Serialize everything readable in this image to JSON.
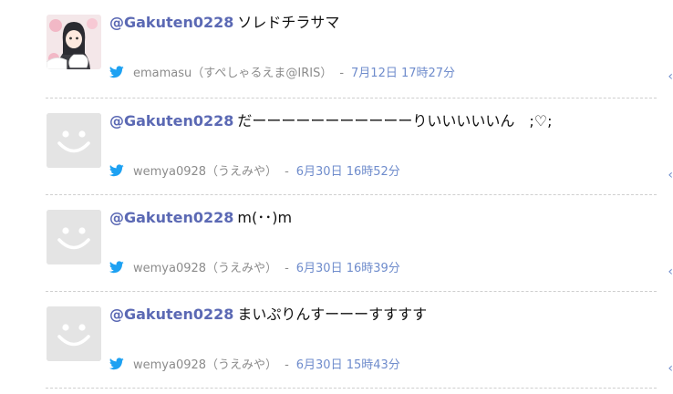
{
  "tweets": [
    {
      "handle": "@Gakuten0228",
      "text": "ソレドチラサマ",
      "username": "emamasu",
      "display_name": "（すぺしゃるえま@IRIS）",
      "separator": "-",
      "time": "7月12日 17時27分",
      "arrow": "‹",
      "avatar": "custom"
    },
    {
      "handle": "@Gakuten0228",
      "text": "だーーーーーーーーーーーりいいいいいん　;♡;",
      "username": "wemya0928",
      "display_name": "（うえみや）",
      "separator": "-",
      "time": "6月30日 16時52分",
      "arrow": "‹",
      "avatar": "default"
    },
    {
      "handle": "@Gakuten0228",
      "text": "m(･･)m",
      "username": "wemya0928",
      "display_name": "（うえみや）",
      "separator": "-",
      "time": "6月30日 16時39分",
      "arrow": "‹",
      "avatar": "default"
    },
    {
      "handle": "@Gakuten0228",
      "text": "まいぷりんすーーーすすすす",
      "username": "wemya0928",
      "display_name": "（うえみや）",
      "separator": "-",
      "time": "6月30日 15時43分",
      "arrow": "‹",
      "avatar": "default"
    }
  ],
  "colors": {
    "handle": "#5b69b4",
    "meta": "#8c8c8c",
    "time": "#6f8ccc",
    "twitter_bird": "#1da1f2"
  },
  "icons": {
    "source": "twitter-bird-icon",
    "default_avatar": "smiley-avatar-icon"
  }
}
